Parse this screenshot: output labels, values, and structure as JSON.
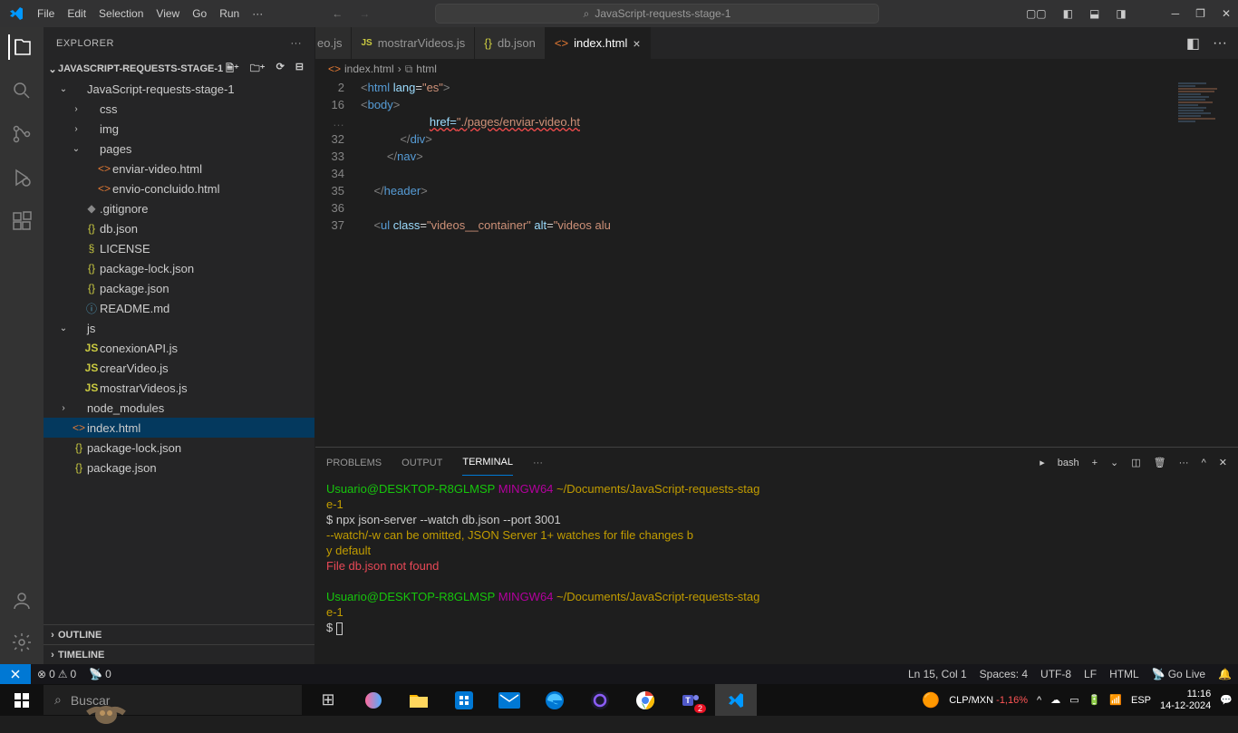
{
  "menu": [
    "File",
    "Edit",
    "Selection",
    "View",
    "Go",
    "Run"
  ],
  "searchTitle": "JavaScript-requests-stage-1",
  "explorer": {
    "title": "EXPLORER",
    "root": "JAVASCRIPT-REQUESTS-STAGE-1"
  },
  "tree": [
    {
      "indent": 1,
      "chev": "⌄",
      "icon": "",
      "name": "JavaScript-requests-stage-1",
      "cls": ""
    },
    {
      "indent": 2,
      "chev": "›",
      "icon": "",
      "name": "css",
      "cls": ""
    },
    {
      "indent": 2,
      "chev": "›",
      "icon": "",
      "name": "img",
      "cls": ""
    },
    {
      "indent": 2,
      "chev": "⌄",
      "icon": "",
      "name": "pages",
      "cls": ""
    },
    {
      "indent": 3,
      "chev": "",
      "icon": "<>",
      "name": "enviar-video.html",
      "cls": "ic-html"
    },
    {
      "indent": 3,
      "chev": "",
      "icon": "<>",
      "name": "envio-concluido.html",
      "cls": "ic-html"
    },
    {
      "indent": 2,
      "chev": "",
      "icon": "◆",
      "name": ".gitignore",
      "cls": "ic-git"
    },
    {
      "indent": 2,
      "chev": "",
      "icon": "{}",
      "name": "db.json",
      "cls": "ic-json"
    },
    {
      "indent": 2,
      "chev": "",
      "icon": "§",
      "name": "LICENSE",
      "cls": "ic-license"
    },
    {
      "indent": 2,
      "chev": "",
      "icon": "{}",
      "name": "package-lock.json",
      "cls": "ic-json"
    },
    {
      "indent": 2,
      "chev": "",
      "icon": "{}",
      "name": "package.json",
      "cls": "ic-json"
    },
    {
      "indent": 2,
      "chev": "",
      "icon": "ⓘ",
      "name": "README.md",
      "cls": "ic-md"
    },
    {
      "indent": 1,
      "chev": "⌄",
      "icon": "",
      "name": "js",
      "cls": ""
    },
    {
      "indent": 2,
      "chev": "",
      "icon": "JS",
      "name": "conexionAPI.js",
      "cls": "ic-js"
    },
    {
      "indent": 2,
      "chev": "",
      "icon": "JS",
      "name": "crearVideo.js",
      "cls": "ic-js"
    },
    {
      "indent": 2,
      "chev": "",
      "icon": "JS",
      "name": "mostrarVideos.js",
      "cls": "ic-js"
    },
    {
      "indent": 1,
      "chev": "›",
      "icon": "",
      "name": "node_modules",
      "cls": ""
    },
    {
      "indent": 1,
      "chev": "",
      "icon": "<>",
      "name": "index.html",
      "cls": "ic-html",
      "selected": true
    },
    {
      "indent": 1,
      "chev": "",
      "icon": "{}",
      "name": "package-lock.json",
      "cls": "ic-json"
    },
    {
      "indent": 1,
      "chev": "",
      "icon": "{}",
      "name": "package.json",
      "cls": "ic-json"
    }
  ],
  "outline": "OUTLINE",
  "timeline": "TIMELINE",
  "tabs": [
    {
      "icon": "JS",
      "label": "eo.js",
      "cls": "ic-js",
      "partial": true
    },
    {
      "icon": "JS",
      "label": "mostrarVideos.js",
      "cls": "ic-js"
    },
    {
      "icon": "{}",
      "label": "db.json",
      "cls": "ic-json"
    },
    {
      "icon": "<>",
      "label": "index.html",
      "cls": "ic-html",
      "active": true
    }
  ],
  "breadcrumb": {
    "file": "index.html",
    "el": "html"
  },
  "code": {
    "lines": [
      "2",
      "16",
      "32",
      "33",
      "34",
      "35",
      "36",
      "37"
    ],
    "l2": "<html lang=\"es\">",
    "l16": "<body>",
    "l31b": "./pages/enviar-video.ht",
    "l32": "            </div>",
    "l33": "        </nav>",
    "l34": "",
    "l35": "    </header>",
    "l36": "",
    "l37": "    <ul class=\"videos__container\" alt=\"videos alu"
  },
  "panel": {
    "tabs": [
      "PROBLEMS",
      "OUTPUT",
      "TERMINAL"
    ],
    "shell": "bash"
  },
  "terminal": {
    "user": "Usuario@DESKTOP-R8GLMSP",
    "ming": "MINGW64",
    "path": "~/Documents/JavaScript-requests-stage-1",
    "cmd": "$ npx json-server --watch db.json --port 3001",
    "warn": "--watch/-w can be omitted, JSON Server 1+ watches for file changes by default",
    "err": "File db.json not found",
    "prompt": "$ "
  },
  "status": {
    "errors": "0",
    "warnings": "0",
    "port": "0",
    "pos": "Ln 15, Col 1",
    "spaces": "Spaces: 4",
    "enc": "UTF-8",
    "eol": "LF",
    "lang": "HTML",
    "live": "Go Live"
  },
  "taskbar": {
    "search": "Buscar",
    "currency": "CLP/MXN",
    "change": "-1,16%",
    "lang": "ESP",
    "time": "11:16",
    "date": "14-12-2024"
  }
}
